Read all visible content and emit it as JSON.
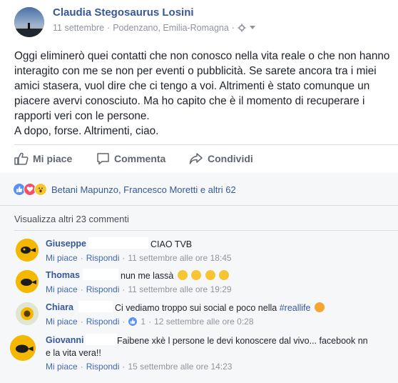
{
  "post": {
    "author": "Claudia Stegosaurus Losini",
    "date": "11 settembre",
    "sep": "·",
    "location": "Podenzano, Emilia-Romagna",
    "sep2": "·",
    "text_lines": [
      "Oggi eliminerò quei contatti che non conosco nella vita reale o che non hanno",
      "interagito con me se non per eventi o pubblicità. Se sarete ancora tra i miei",
      "amici stasera, vuol dire che ci tengo a voi. Altrimenti è stato comunque un",
      "piacere avervi conosciuto. Ma ho capito che è il momento di recuperare i",
      "rapporti veri con le persone.",
      "A dopo, forse. Altrimenti, ciao."
    ]
  },
  "actions": {
    "like": "Mi piace",
    "comment": "Commenta",
    "share": "Condividi"
  },
  "reactions": {
    "summary": "Betani Mapunzo, Francesco Moretti e altri 62",
    "icons": [
      "like-reaction",
      "love-reaction",
      "wow-reaction"
    ]
  },
  "more_comments": "Visualizza altri 23 commenti",
  "comments": [
    {
      "author": "Giuseppe",
      "text": "CIAO TVB",
      "like": "Mi piace",
      "sep": "·",
      "reply": "Rispondi",
      "sep2": "·",
      "time": "11 settembre alle ore 18:45"
    },
    {
      "author": "Thomas",
      "text": "nun me lassà",
      "like": "Mi piace",
      "sep": "·",
      "reply": "Rispondi",
      "sep2": "·",
      "time": "11 settembre alle ore 19:29"
    },
    {
      "author": "Chiara",
      "text": "Ci vediamo troppo sui social e poco nella",
      "hashtag": "#reallife",
      "like": "Mi piace",
      "sep": "·",
      "reply": "Rispondi",
      "sep2": "·",
      "like_count": "1",
      "sep3": "·",
      "time": "12 settembre alle ore 0:28"
    },
    {
      "author": "Giovanni",
      "text_line1": "Faibene xkè l persone le devi konoscere dal vivo... facebook nn",
      "text_line2": "e la vita vera!!",
      "like": "Mi piace",
      "sep": "·",
      "reply": "Rispondi",
      "sep2": "·",
      "time": "15 settembre alle ore 14:23"
    }
  ],
  "colors": {
    "link_blue": "#365899",
    "action_blue": "#4267b2",
    "meta_gray": "#90949c",
    "comments_bg": "#f6f7f9",
    "avatar_yellow": "#f5b800"
  }
}
